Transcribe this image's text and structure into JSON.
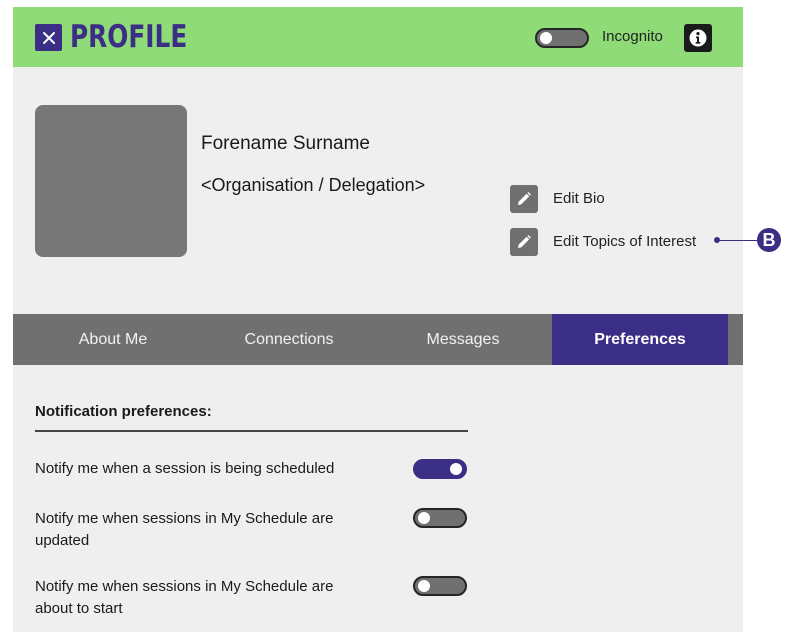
{
  "header": {
    "title": "PROFILE",
    "incognito_label": "Incognito",
    "incognito_on": false
  },
  "profile": {
    "name": "Forename Surname",
    "organisation": "<Organisation / Delegation>"
  },
  "actions": {
    "edit_bio": "Edit Bio",
    "edit_topics": "Edit Topics of Interest"
  },
  "tabs": [
    {
      "label": "About Me",
      "active": false
    },
    {
      "label": "Connections",
      "active": false
    },
    {
      "label": "Messages",
      "active": false
    },
    {
      "label": "Preferences",
      "active": true
    }
  ],
  "preferences": {
    "section_title": "Notification preferences:",
    "items": [
      {
        "label": "Notify me when a session is being scheduled",
        "on": true
      },
      {
        "label": "Notify me when sessions in My Schedule are updated",
        "on": false
      },
      {
        "label": "Notify me when sessions in My Schedule are about to start",
        "on": false
      }
    ]
  },
  "annotation": {
    "badge": "B"
  },
  "colors": {
    "header_bg": "#8edb78",
    "accent": "#3a2e86",
    "tab_bar": "#707070",
    "panel_bg": "#efefef"
  },
  "icons": {
    "close": "close-icon",
    "info": "info-icon",
    "edit": "pencil-icon"
  }
}
